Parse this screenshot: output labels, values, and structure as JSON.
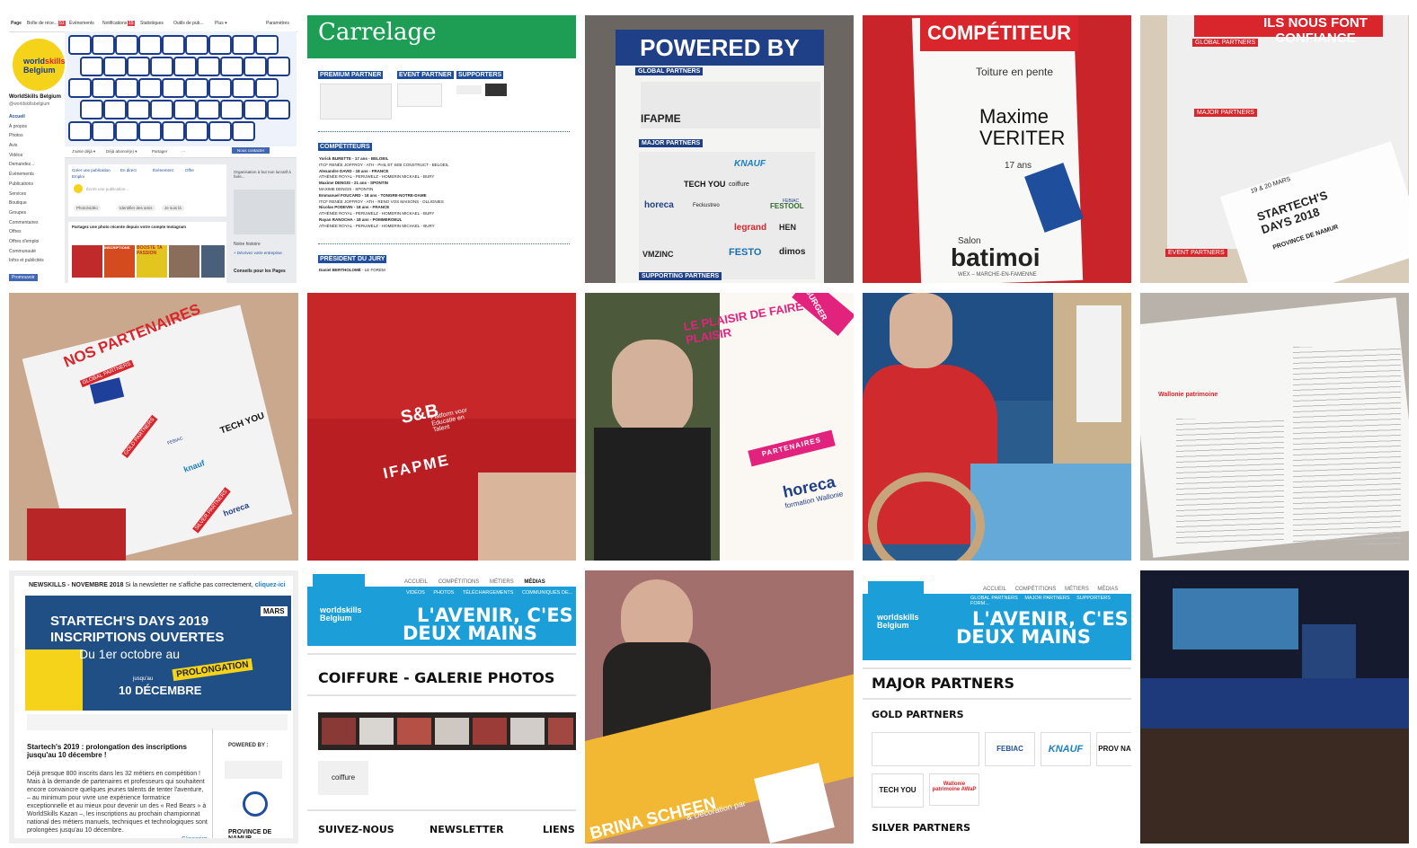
{
  "facebook": {
    "tabs": [
      "Page",
      "Boîte de réce...",
      "Événements",
      "Notifications",
      "Statistiques",
      "Outils de pub...",
      "Plus ▾",
      "Paramètres"
    ],
    "badges": [
      "51",
      "15"
    ],
    "page_name": "WorldSkills Belgium",
    "handle": "@worldskillsbelgium",
    "sidebar": [
      "Accueil",
      "À propos",
      "Photos",
      "Avis",
      "Vidéos",
      "Demandez...",
      "Événements",
      "Publications",
      "Services",
      "Boutique",
      "Groupes",
      "Commentaires",
      "Offres",
      "Offres d'emploi",
      "Communauté",
      "Infos et publicités"
    ],
    "promote": "Promouvoir",
    "actions": [
      "J'aime déjà ▾",
      "Déjà abonné(e) ▾",
      "Partager",
      "···"
    ],
    "contact": "Nous contacter",
    "composer": [
      "Créer une publication",
      "En direct",
      "Événement",
      "Offre",
      "Emploi"
    ],
    "write_placeholder": "Écrire une publication...",
    "composer_chips": [
      "Photo/vidéo",
      "Identifier des amis",
      "Je suis là"
    ],
    "instagram": "Partagez une photo récente depuis votre compte Instagram",
    "org": "Organisation à but non lucratif à faire...",
    "story": "Notre histoire",
    "describe": "+ Décrivez votre entreprise",
    "tips": "Conseils pour les Pages",
    "instagram_text": "INSCRIPTIONS",
    "boost_text": "BOOSTE TA PASSION"
  },
  "carrelage": {
    "title": "Carrelage",
    "badges": [
      "PREMIUM PARTNER",
      "EVENT PARTNER",
      "SUPPORTERS"
    ],
    "competitors_label": "COMPÉTITEURS",
    "competitors": [
      {
        "name": "Yorick BURETTE - 17 ans - BELOEIL",
        "school": "ITCF RENÉE JOFFROY - ATH - PHIL ET SEB CONSTRUCT - BELOEIL"
      },
      {
        "name": "Alexandre DAVID - 18 ans - FRANCE",
        "school": "ATHÉNÉE ROYAL - PERUWELZ - HOMERIN MICKAEL - BURY"
      },
      {
        "name": "Maxime DENGIS - 21 ans - SPONTIN",
        "school": "MAXIME DENGIS - SPONTIN"
      },
      {
        "name": "Emmanuel FOUCARD - 18 ans - TONGRE-NOTRE-DAME",
        "school": "ITCF RENÉE JOFFROY - ATH - RENO VOS MAISONS - OLLIGNIES"
      },
      {
        "name": "Nicolas PODEVIN - 18 ans - FRANCE",
        "school": "ATHÉNÉE ROYAL - PERUWELZ - HOMERIN MICKAEL - BURY"
      },
      {
        "name": "Rayan RANOCHA - 18 ans - POMMEROEUL",
        "school": "ATHÉNÉE ROYAL - PERUWELZ - HOMERIN MICHAEL - BURY"
      }
    ],
    "jury_label": "PRÉSIDENT DU JURY",
    "jury": "Daniel BERTHOLOMÉ",
    "jury_org": " - LE FOREM"
  },
  "powered": {
    "title": "POWERED BY",
    "global": "GLOBAL PARTNERS",
    "major": "MAJOR PARTNERS",
    "supporting": "SUPPORTING PARTNERS",
    "logos": [
      "IFAPME",
      "TECH YOU",
      "KNAUF",
      "FEBIAC",
      "horeca",
      "FESTOOL",
      "legrand",
      "HEN",
      "VMZINC",
      "FESTO",
      "dimos",
      "Feckustreo",
      "coiffure"
    ]
  },
  "competiteur": {
    "title": "COMPÉTITEUR",
    "trade": "Toiture en pente",
    "first": "Maxime",
    "last": "VERITER",
    "age": "17 ans",
    "salon": "Salon",
    "brand": "batimoi",
    "place": "WEX – MARCHE-EN-FAMENNE"
  },
  "confiance": {
    "title": "ILS NOUS FONT CONFIANCE",
    "labels": [
      "GLOBAL PARTNERS",
      "MAJOR PARTNERS",
      "EVENT PARTNERS"
    ],
    "startech": "STARTECH'S DAYS 2018",
    "dates": "19 & 20 MARS",
    "province": "PROVINCE DE NAMUR"
  },
  "nos": {
    "title": "NOS PARTENAIRES",
    "labels": [
      "GLOBAL PARTNERS",
      "GOLD PARTNERS",
      "SILVER PARTNERS"
    ],
    "logos": [
      "TECH YOU",
      "knauf",
      "horeca",
      "FEBIAC"
    ]
  },
  "sleeve": {
    "logo": "S&B",
    "sub": "Platform voor Educatie en Talent",
    "ifapme": "IFAPME"
  },
  "magazine": {
    "headline": "LE PLAISIR DE FAIRE PLAISIR",
    "tag": "PARTENAIRES",
    "brand": "horeca",
    "brand_sub": "formation Wallonie",
    "corner": "BURGER"
  },
  "newsletter": {
    "header_left": "NEWSKILLS - NOVEMBRE 2018",
    "header_mid": "Si la newsletter ne s'affiche pas correctement,",
    "header_link": "cliquez-ici",
    "banner_title": "STARTECH'S DAYS 2019",
    "banner_sub": "INSCRIPTIONS OUVERTES",
    "banner_from": "Du 1er octobre au",
    "banner_prolong": "PROLONGATION",
    "banner_until": "jusqu'au",
    "banner_date": "10 DÉCEMBRE",
    "mars": "MARS",
    "article_title": "Startech's 2019 : prolongation des inscriptions jusqu'au 10 décembre !",
    "article_body": "Déjà presque 800 inscrits dans les 32 métiers en compétition ! Mais à la demande de partenaires et professeurs qui souhaitent encore convaincre quelques jeunes talents de tenter l'aventure, – au minimum pour vivre une expérience formatrice exceptionnelle et au mieux pour devenir un des « Red Bears » à WorldSkills Kazan –, les inscriptions au prochain championnat national des métiers manuels, techniques et technologiques sont prolongées jusqu'au 10 décembre.",
    "powered": "POWERED BY :",
    "signup": "S'inscrire",
    "province": "PROVINCE DE NAMUR"
  },
  "coiffure": {
    "nav": [
      "ACCUEIL",
      "COMPÉTITIONS",
      "MÉTIERS",
      "MÉDIAS"
    ],
    "subnav": [
      "VIDÉOS",
      "PHOTOS",
      "TÉLÉCHARGEMENTS",
      "COMMUNIQUÉS DE..."
    ],
    "slogan1": "L'AVENIR, C'ES",
    "slogan2": "DEUX MAINS",
    "title": "COIFFURE - GALERIE PHOTOS",
    "footer": [
      "SUIVEZ-NOUS",
      "NEWSLETTER",
      "LIENS"
    ]
  },
  "poster": {
    "name": "BRINA SCHEEN",
    "sub": "& Décoration par"
  },
  "partners_site": {
    "nav": [
      "ACCUEIL",
      "COMPÉTITIONS",
      "MÉTIERS",
      "MÉDIAS"
    ],
    "subnav": [
      "GLOBAL PARTNERS",
      "MAJOR PARTNERS",
      "SUPPORTERS",
      "FORM..."
    ],
    "slogan1": "L'AVENIR, C'ES",
    "slogan2": "DEUX MAINS",
    "title": "MAJOR PARTNERS",
    "gold": "GOLD PARTNERS",
    "silver": "SILVER PARTNERS",
    "logos": [
      "FEBIAC",
      "KNAUF",
      "TECH YOU",
      "Wallonie patrimoine AWaP",
      "PROV NA"
    ]
  },
  "brand": {
    "world": "world",
    "skills": "skills",
    "belgium": "Belgium"
  },
  "colors": {
    "blue": "#1c9fd8",
    "red": "#d8262c",
    "green": "#1e9e55",
    "navy": "#1f4f9c",
    "yellow": "#f5d31a"
  }
}
